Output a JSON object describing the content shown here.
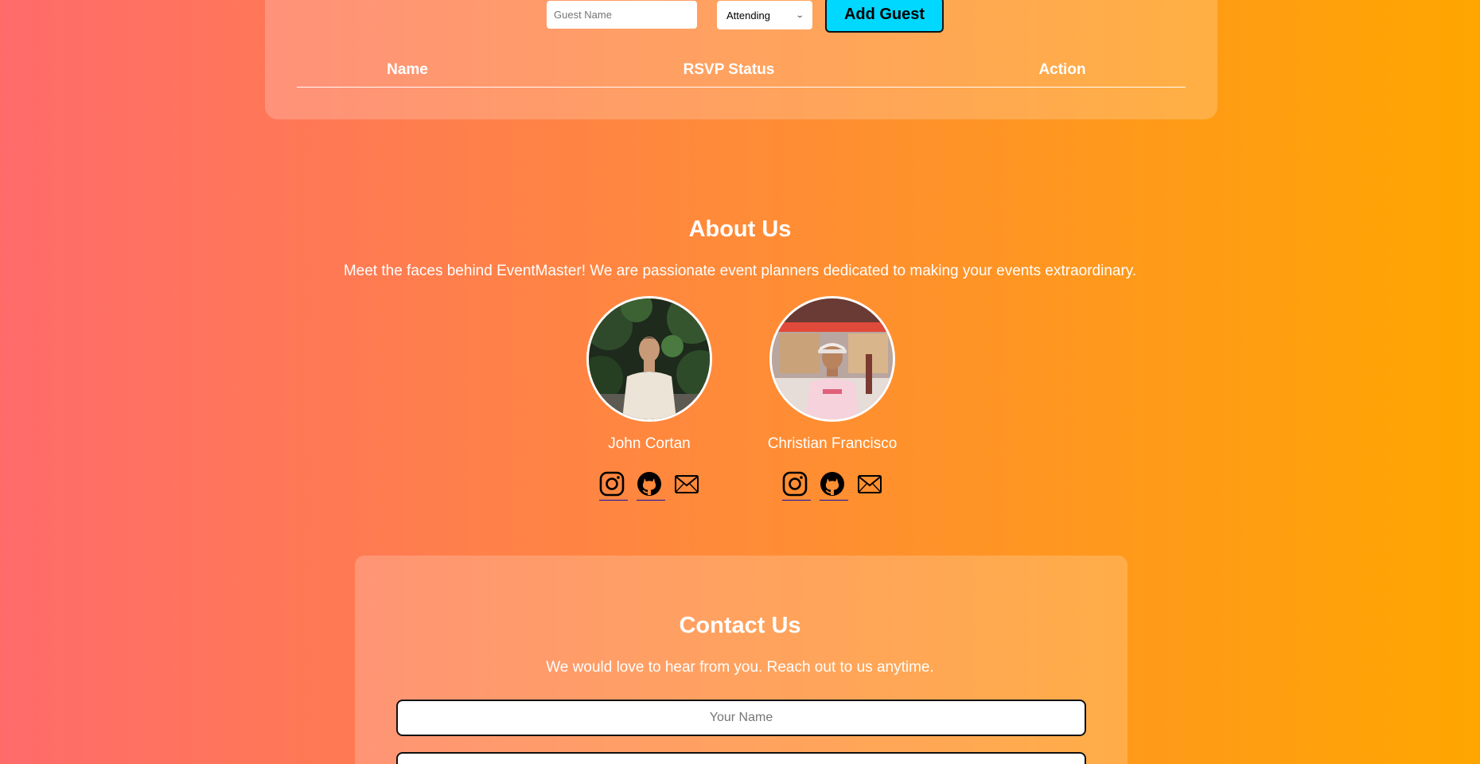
{
  "rsvp": {
    "guest_name_placeholder": "Guest Name",
    "status_selected": "Attending",
    "add_guest_label": "Add Guest",
    "table_headers": [
      "Name",
      "RSVP Status",
      "Action"
    ]
  },
  "about": {
    "title": "About Us",
    "description": "Meet the faces behind EventMaster! We are passionate event planners dedicated to making your events extraordinary.",
    "members": [
      {
        "name": "John Cortan",
        "socials": [
          "instagram-icon",
          "github-icon",
          "mail-icon"
        ]
      },
      {
        "name": "Christian Francisco",
        "socials": [
          "instagram-icon",
          "github-icon",
          "mail-icon"
        ]
      }
    ]
  },
  "contact": {
    "title": "Contact Us",
    "description": "We would love to hear from you. Reach out to us anytime.",
    "name_placeholder": "Your Name",
    "email_placeholder": ""
  },
  "colors": {
    "gradient_start": "#ff6b6b",
    "gradient_end": "#ffa600",
    "button_accent": "#00d8ff"
  }
}
